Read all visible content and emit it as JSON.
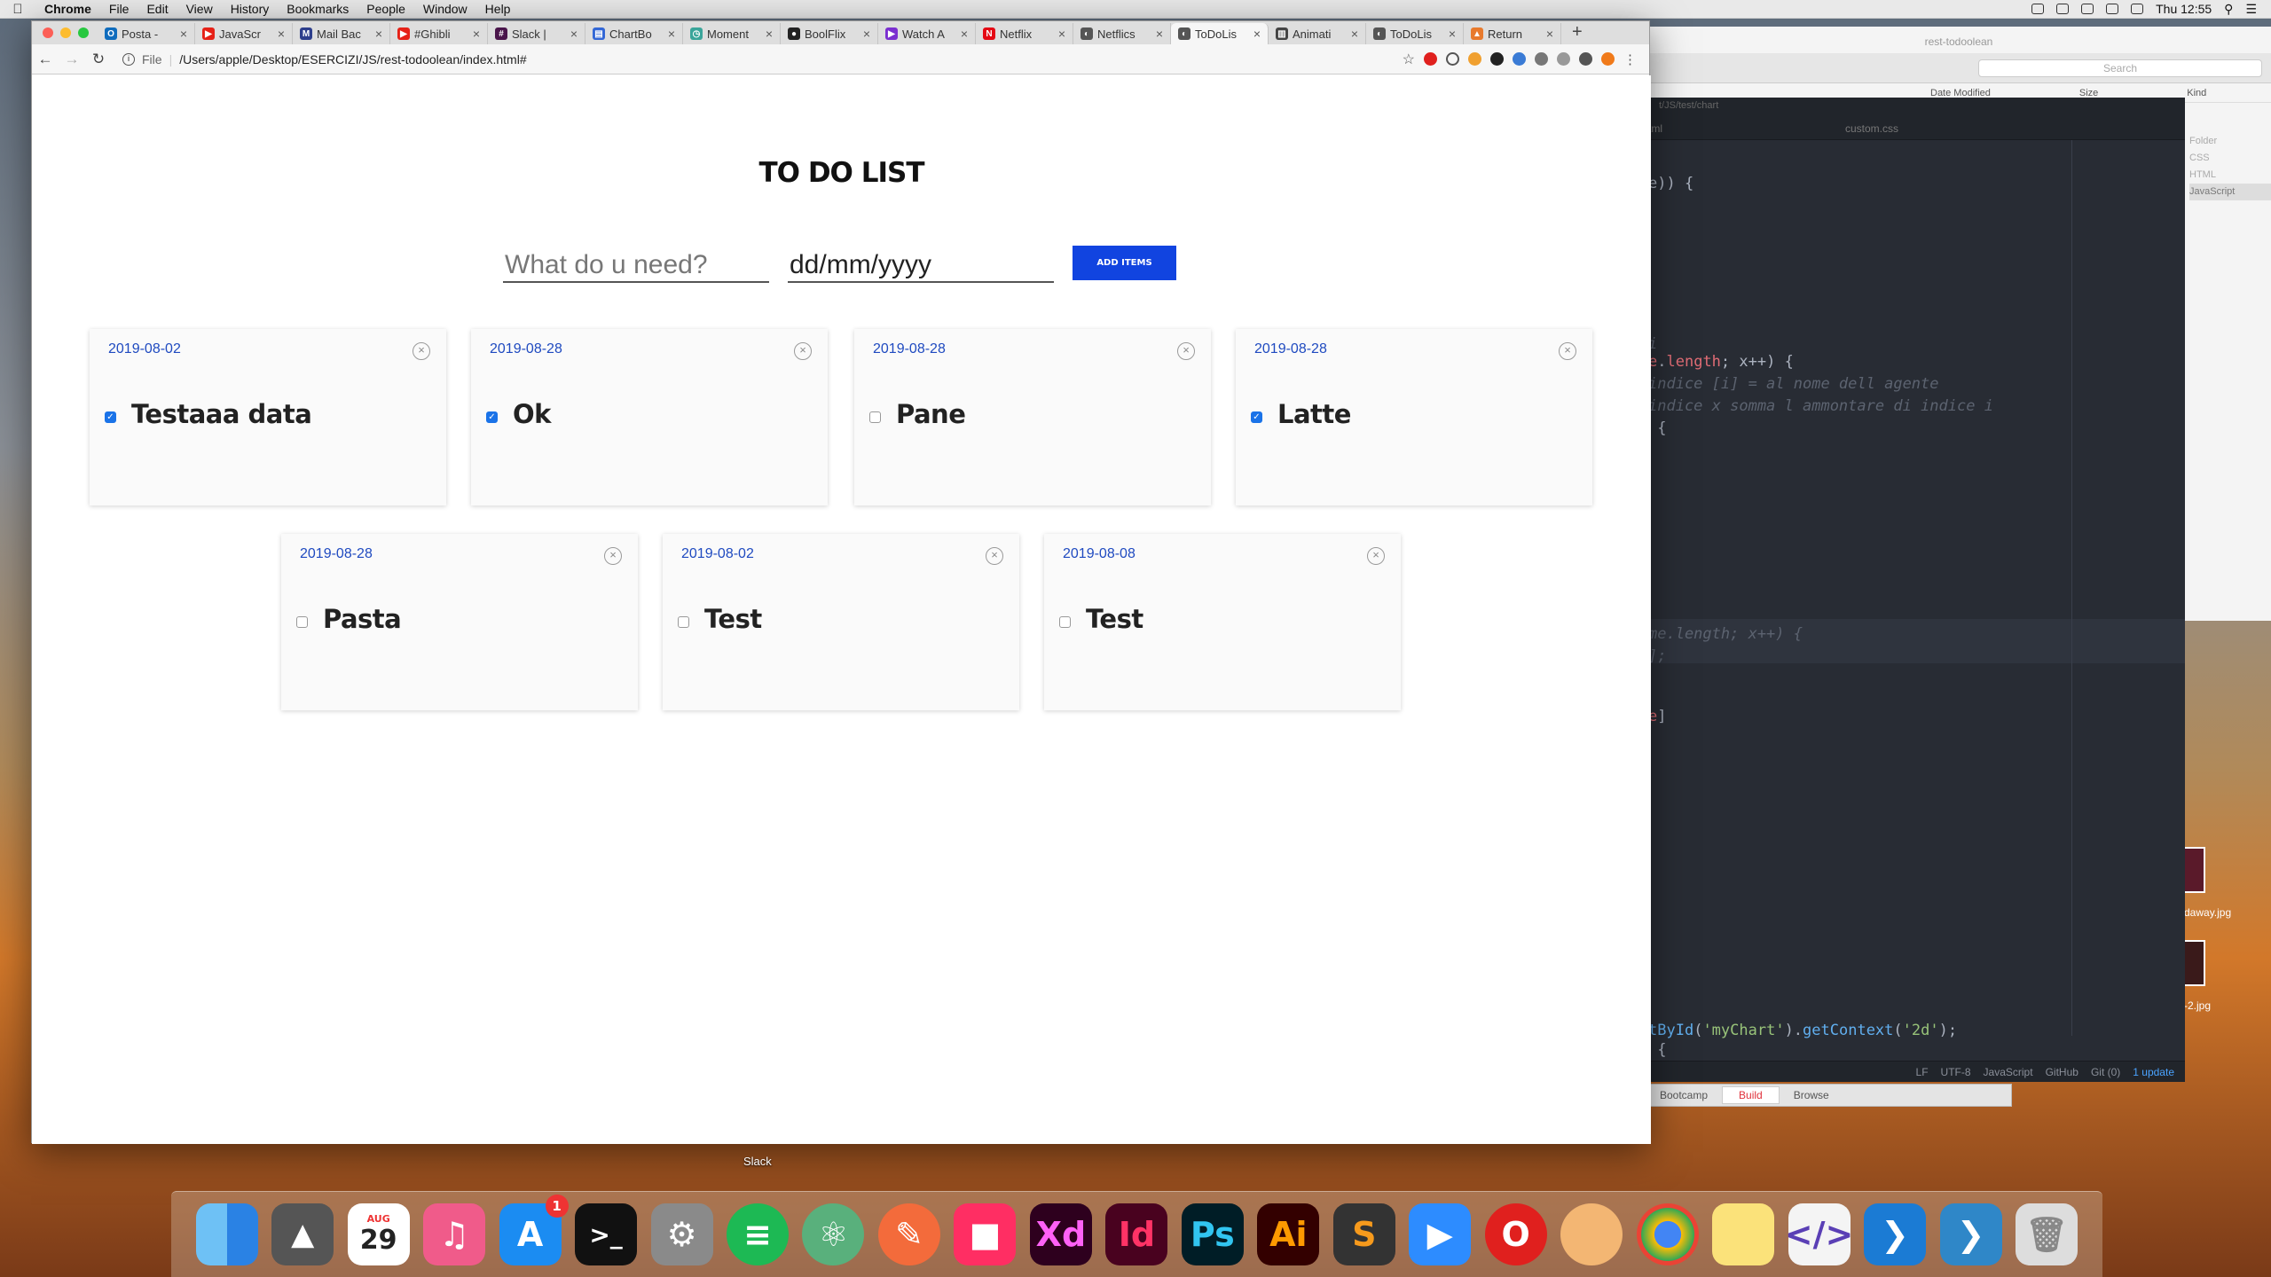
{
  "menubar": {
    "app": "Chrome",
    "items": [
      "File",
      "Edit",
      "View",
      "History",
      "Bookmarks",
      "People",
      "Window",
      "Help"
    ],
    "clock": "Thu 12:55"
  },
  "browser": {
    "tabs": [
      {
        "label": "Posta -",
        "color": "#0f6cbd",
        "glyph": "O"
      },
      {
        "label": "JavaScr",
        "color": "#e62117",
        "glyph": "▶"
      },
      {
        "label": "Mail Bac",
        "color": "#2d3e8c",
        "glyph": "M"
      },
      {
        "label": "#Ghibli",
        "color": "#e62117",
        "glyph": "▶"
      },
      {
        "label": "Slack | ",
        "color": "#4a154b",
        "glyph": "#"
      },
      {
        "label": "ChartBo",
        "color": "#3367d6",
        "glyph": "▤"
      },
      {
        "label": "Moment",
        "color": "#3aa59a",
        "glyph": "◷"
      },
      {
        "label": "BoolFlix",
        "color": "#222",
        "glyph": "●"
      },
      {
        "label": "Watch A",
        "color": "#7b2fd0",
        "glyph": "▶"
      },
      {
        "label": "Netflix",
        "color": "#e50914",
        "glyph": "N"
      },
      {
        "label": "Netflics",
        "color": "#555",
        "glyph": "◐"
      },
      {
        "label": "ToDoLis",
        "color": "#555",
        "glyph": "◐",
        "active": true
      },
      {
        "label": "Animati",
        "color": "#444",
        "glyph": "▥"
      },
      {
        "label": "ToDoLis",
        "color": "#555",
        "glyph": "◐"
      },
      {
        "label": "Return",
        "color": "#e87a2d",
        "glyph": "▲"
      }
    ],
    "url_scheme": "File",
    "url": "/Users/apple/Desktop/ESERCIZI/JS/rest-todoolean/index.html#"
  },
  "page": {
    "title": "TO DO LIST",
    "item_placeholder": "What do u need?",
    "date_placeholder": "dd/mm/yyyy",
    "add_button": "ADD ITEMS",
    "cards": [
      {
        "date": "2019-08-02",
        "text": "Testaaa data",
        "checked": true
      },
      {
        "date": "2019-08-28",
        "text": "Ok",
        "checked": true
      },
      {
        "date": "2019-08-28",
        "text": "Pane",
        "checked": false
      },
      {
        "date": "2019-08-28",
        "text": "Latte",
        "checked": true
      },
      {
        "date": "2019-08-28",
        "text": "Pasta",
        "checked": false
      },
      {
        "date": "2019-08-02",
        "text": "Test",
        "checked": false
      },
      {
        "date": "2019-08-08",
        "text": "Test",
        "checked": false
      }
    ]
  },
  "finder": {
    "title": "rest-todoolean",
    "search": "Search",
    "columns": [
      "Date Modified",
      "Size",
      "Kind"
    ],
    "kinds": [
      "Folder",
      "CSS",
      "HTML",
      "JavaScript"
    ]
  },
  "editor": {
    "path": "t/JS/test/chart",
    "tabs": [
      "tml",
      "custom.css"
    ],
    "status": [
      "LF",
      "UTF-8",
      "JavaScript",
      "GitHub",
      "Git (0)",
      "1 update"
    ]
  },
  "buildbar": {
    "build": "Build",
    "browse": "Browse",
    "app": "Bootcamp"
  },
  "desktop": {
    "slack_label": "Slack",
    "file1": "daway.jpg",
    "file2": "-2.jpg"
  },
  "dock": {
    "calendar_month": "AUG",
    "calendar_day": "29",
    "appstore_badge": "1"
  }
}
